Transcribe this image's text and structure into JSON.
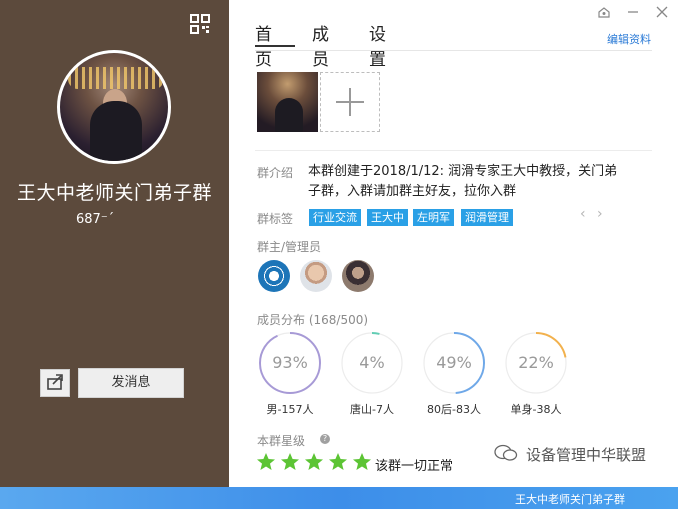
{
  "left_panel": {
    "group_name": "王大中老师关门弟子群",
    "group_id": "687⁻´",
    "send_button_label": "发消息"
  },
  "header": {
    "tabs": [
      {
        "label": "首页",
        "active": true
      },
      {
        "label": "成员",
        "active": false
      },
      {
        "label": "设置",
        "active": false
      }
    ],
    "edit_link": "编辑资料"
  },
  "intro": {
    "label": "群介绍",
    "text": "本群创建于2018/1/12:  润滑专家王大中教授，关门弟子群，入群请加群主好友，拉你入群"
  },
  "tags": {
    "label": "群标签",
    "items": [
      "行业交流",
      "王大中",
      "左明军",
      "润滑管理"
    ]
  },
  "admins": {
    "label": "群主/管理员"
  },
  "distribution": {
    "label": "成员分布 (168/500)",
    "stats": [
      {
        "value": "93%",
        "fraction": 0.93,
        "label": "男-157人",
        "color": "#a79ad6"
      },
      {
        "value": "4%",
        "fraction": 0.04,
        "label": "唐山-7人",
        "color": "#62cdb4"
      },
      {
        "value": "49%",
        "fraction": 0.49,
        "label": "80后-83人",
        "color": "#6fa8e8"
      },
      {
        "value": "22%",
        "fraction": 0.22,
        "label": "单身-38人",
        "color": "#f2b14d"
      }
    ]
  },
  "rating": {
    "label": "本群星级",
    "stars": 5,
    "star_color": "#5cc434",
    "text": "该群一切正常"
  },
  "watermark": {
    "text": "设备管理中华联盟"
  },
  "bottom_bar": {
    "title": "王大中老师关门弟子群"
  }
}
